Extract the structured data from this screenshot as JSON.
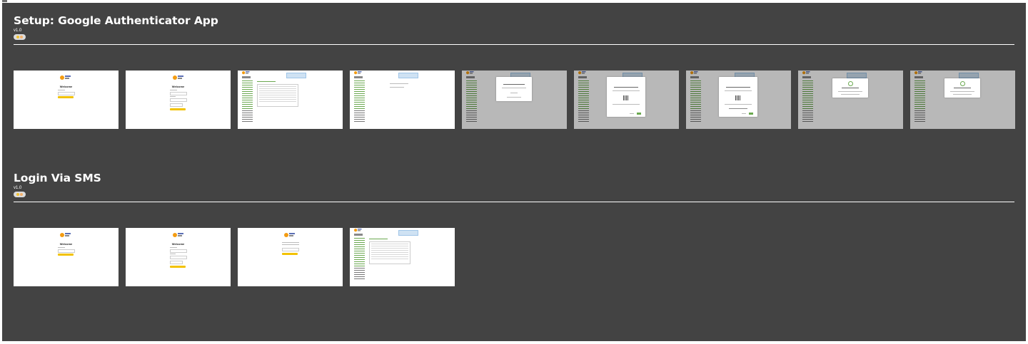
{
  "flows": [
    {
      "title": "Setup: Google Authenticator App",
      "version": "v1.0",
      "status_colors": [
        "#f1c232",
        "#f6b26b"
      ],
      "screens": [
        {
          "kind": "login",
          "name": "welcome-login"
        },
        {
          "kind": "login-form",
          "name": "welcome-login-form"
        },
        {
          "kind": "dashboard",
          "name": "dashboard-table"
        },
        {
          "kind": "dashboard-empty",
          "name": "dashboard-settings"
        },
        {
          "kind": "modal-small",
          "name": "secure-account-modal"
        },
        {
          "kind": "modal-qr",
          "name": "authenticator-qr-modal"
        },
        {
          "kind": "modal-qr-code",
          "name": "authenticator-code-modal"
        },
        {
          "kind": "modal-success",
          "name": "success-modal-1"
        },
        {
          "kind": "modal-success",
          "name": "success-modal-2"
        }
      ]
    },
    {
      "title": "Login Via SMS",
      "version": "v1.0",
      "status_colors": [
        "#f1c232",
        "#f6b26b"
      ],
      "screens": [
        {
          "kind": "login",
          "name": "sms-welcome-login"
        },
        {
          "kind": "login-form",
          "name": "sms-welcome-login-form"
        },
        {
          "kind": "sms-code",
          "name": "sms-code-entry"
        },
        {
          "kind": "dashboard",
          "name": "sms-dashboard"
        }
      ]
    }
  ],
  "screen_text": {
    "welcome": "Welcome"
  }
}
